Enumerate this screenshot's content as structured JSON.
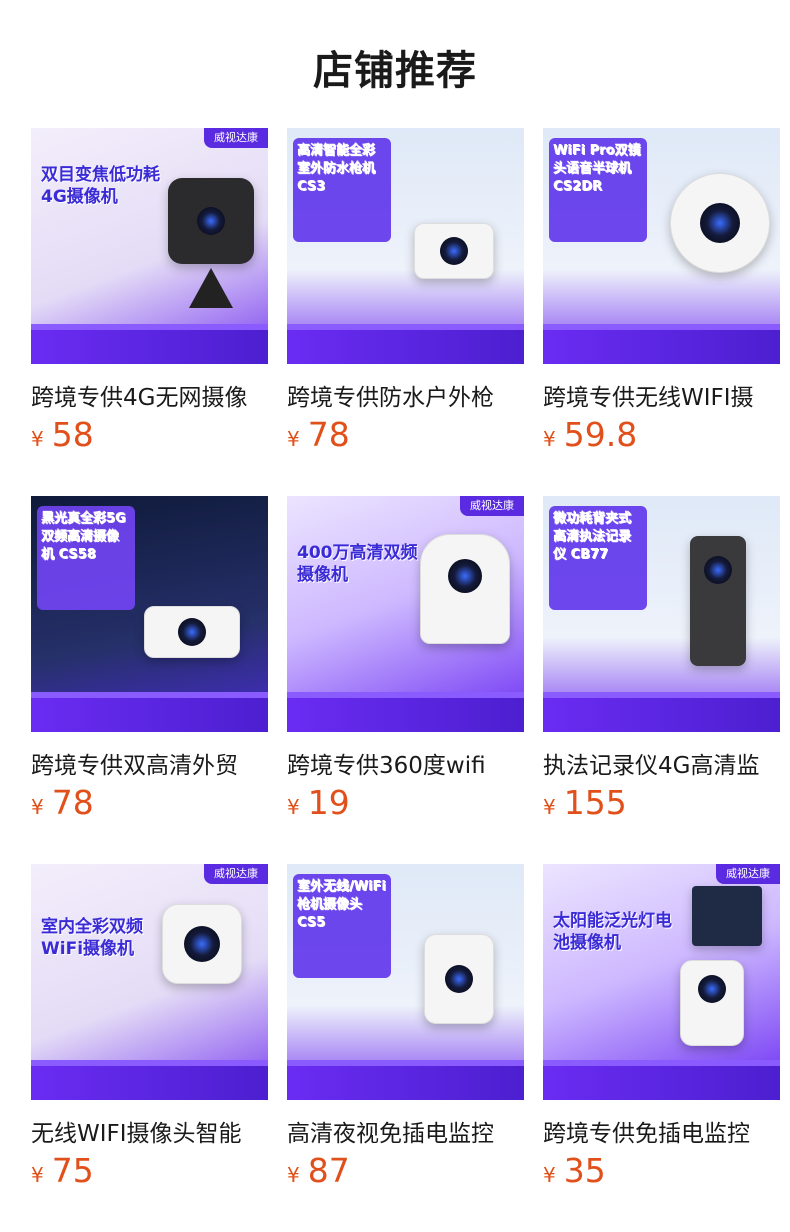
{
  "page": {
    "title": "店铺推荐"
  },
  "products": [
    {
      "name": "跨境专供4G无网摄像",
      "currency": "¥",
      "price": "58",
      "img_text": "双目变焦低功耗4G摄像机",
      "img_brand": "威视达康",
      "theme": "light"
    },
    {
      "name": "跨境专供防水户外枪",
      "currency": "¥",
      "price": "78",
      "img_text": "高清智能全彩室外防水枪机 CS3",
      "img_brand": "",
      "theme": "sky"
    },
    {
      "name": "跨境专供无线WIFI摄",
      "currency": "¥",
      "price": "59.8",
      "img_text": "WiFi Pro双镜头语音半球机 CS2DR",
      "img_brand": "",
      "theme": "sky"
    },
    {
      "name": "跨境专供双高清外贸",
      "currency": "¥",
      "price": "78",
      "img_text": "黑光真全彩5G双频高清摄像机 CS58",
      "img_brand": "",
      "theme": "dark"
    },
    {
      "name": "跨境专供360度wifi",
      "currency": "¥",
      "price": "19",
      "img_text": "400万高清双频摄像机",
      "img_brand": "威视达康",
      "theme": "purple"
    },
    {
      "name": "执法记录仪4G高清监",
      "currency": "¥",
      "price": "155",
      "img_text": "微功耗背夹式高清执法记录仪 CB77",
      "img_brand": "",
      "theme": "sky"
    },
    {
      "name": "无线WIFI摄像头智能",
      "currency": "¥",
      "price": "75",
      "img_text": "室内全彩双频WiFi摄像机",
      "img_brand": "威视达康",
      "theme": "light"
    },
    {
      "name": "高清夜视免插电监控",
      "currency": "¥",
      "price": "87",
      "img_text": "室外无线/WiFi枪机摄像头 CS5",
      "img_brand": "",
      "theme": "sky"
    },
    {
      "name": "跨境专供免插电监控",
      "currency": "¥",
      "price": "35",
      "img_text": "太阳能泛光灯电池摄像机",
      "img_brand": "威视达康",
      "theme": "purple"
    }
  ],
  "colors": {
    "price": "#e1501a",
    "brand_purple": "#5a2be0"
  }
}
